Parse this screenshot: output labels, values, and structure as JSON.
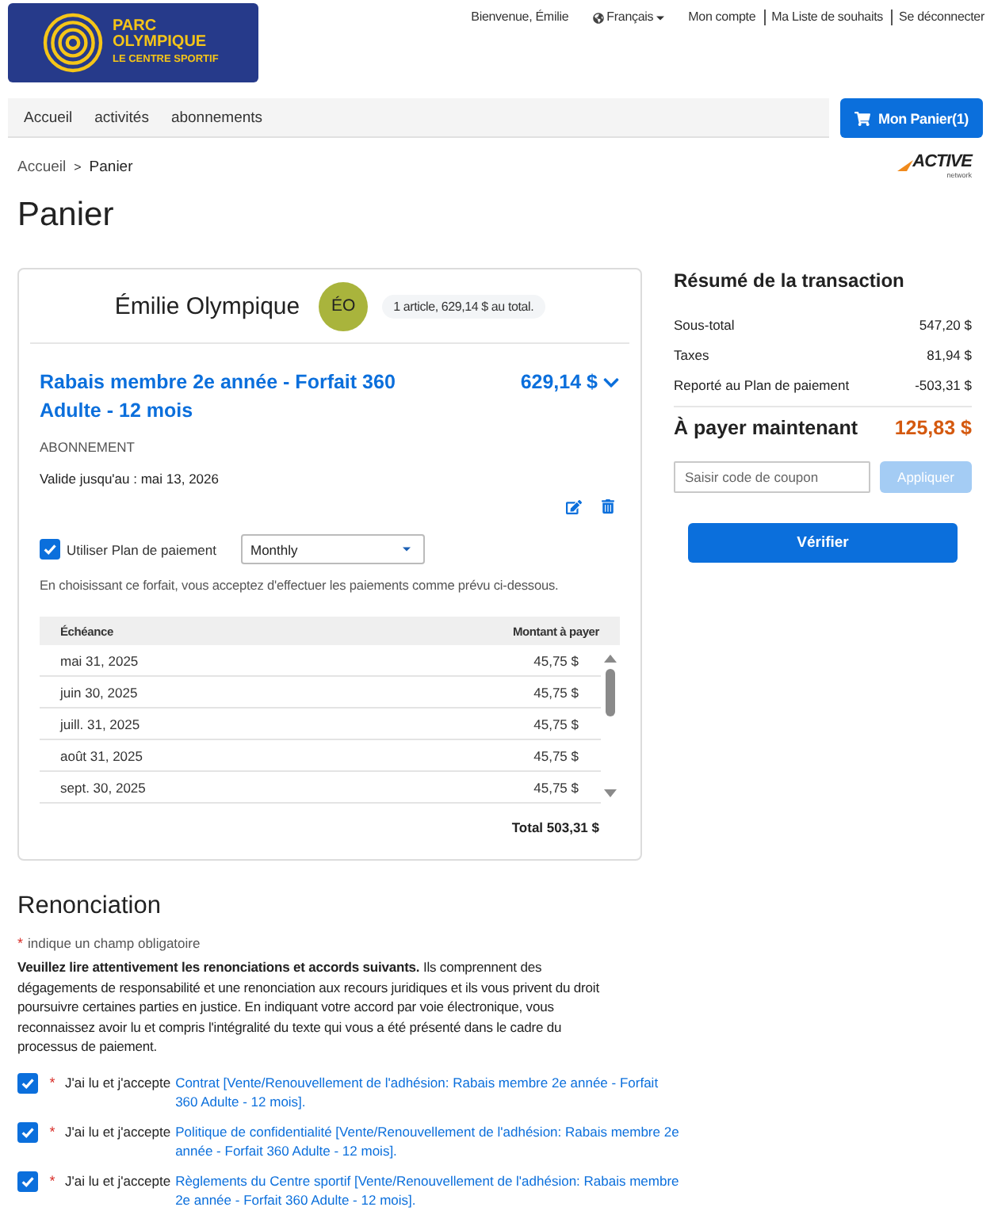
{
  "header": {
    "logo": {
      "title": "PARC OLYMPIQUE",
      "subtitle": "LE CENTRE SPORTIF"
    },
    "top_links": [
      {
        "label": "Bienvenue, Émilie",
        "kind": "greeting"
      },
      {
        "label": "Français",
        "kind": "language"
      },
      {
        "label": "Mon compte",
        "kind": "link"
      },
      {
        "label": "Ma Liste de souhaits",
        "kind": "link"
      },
      {
        "label": "Se déconnecter",
        "kind": "link"
      }
    ]
  },
  "nav": {
    "items": [
      {
        "label": "Accueil"
      },
      {
        "label": "activités"
      },
      {
        "label": "abonnements"
      }
    ],
    "cart_button": "Mon Panier(1)"
  },
  "breadcrumb": {
    "items": [
      "Accueil",
      "Panier"
    ],
    "separator": ">"
  },
  "partner_logo": {
    "name": "ACTIVE",
    "tagline": "network"
  },
  "page_title": "Panier",
  "cart": {
    "customer": {
      "name": "Émilie Olympique",
      "initials": "ÉO",
      "summary": "1 article, 629,14 $ au total."
    },
    "item": {
      "title": "Rabais membre 2e année - Forfait 360 Adulte - 12 mois",
      "price": "629,14 $",
      "type": "ABONNEMENT",
      "validity": "Valide jusqu'au : mai 13, 2026"
    },
    "payment_plan": {
      "label": "Utiliser Plan de paiement",
      "checked": true,
      "frequency": "Monthly",
      "note": "En choisissant ce forfait, vous acceptez d'effectuer les paiements comme prévu ci-dessous."
    },
    "schedule": {
      "columns": [
        "Échéance",
        "Montant à payer"
      ],
      "rows": [
        [
          "mai 31, 2025",
          "45,75 $"
        ],
        [
          "juin 30, 2025",
          "45,75 $"
        ],
        [
          "juill. 31, 2025",
          "45,75 $"
        ],
        [
          "août 31, 2025",
          "45,75 $"
        ],
        [
          "sept. 30, 2025",
          "45,75 $"
        ]
      ],
      "total": "Total 503,31 $"
    }
  },
  "summary": {
    "title": "Résumé de la transaction",
    "rows": [
      {
        "label": "Sous-total",
        "value": "547,20 $"
      },
      {
        "label": "Taxes",
        "value": "81,94 $"
      },
      {
        "label": "Reporté au Plan de paiement",
        "value": "-503,31 $"
      }
    ],
    "due": {
      "label": "À payer maintenant",
      "value": "125,83 $"
    },
    "coupon": {
      "placeholder": "Saisir code de coupon",
      "button": "Appliquer",
      "disabled": true
    },
    "checkout_button": "Vérifier"
  },
  "waiver": {
    "title": "Renonciation",
    "required_mark": "*",
    "required_note": "indique un champ obligatoire",
    "intro": "**Veuillez lire attentivement les renonciations et accords suivants.** Ils comprennent des dégagements de responsabilité et une renonciation aux recours juridiques et ils vous privent du droit poursuivre certaines parties en justice. En indiquant votre accord par voie électronique, vous reconnaissez avoir lu et compris l'intégralité du texte qui vous a été présenté dans le cadre du processus de paiement.",
    "agreements": [
      {
        "prefix": "J'ai lu et j'accepte",
        "link": "Contrat [Vente/Renouvellement de l'adhésion: Rabais membre 2e année - Forfait 360 Adulte - 12 mois].",
        "checked": true,
        "required": true
      },
      {
        "prefix": "J'ai lu et j'accepte",
        "link": "Politique de confidentialité [Vente/Renouvellement de l'adhésion: Rabais membre 2e année - Forfait 360 Adulte - 12 mois].",
        "checked": true,
        "required": true
      },
      {
        "prefix": "J'ai lu et j'accepte",
        "link": "Règlements du Centre sportif [Vente/Renouvellement de l'adhésion: Rabais membre 2e année - Forfait 360 Adulte - 12 mois].",
        "checked": true,
        "required": true
      }
    ]
  }
}
